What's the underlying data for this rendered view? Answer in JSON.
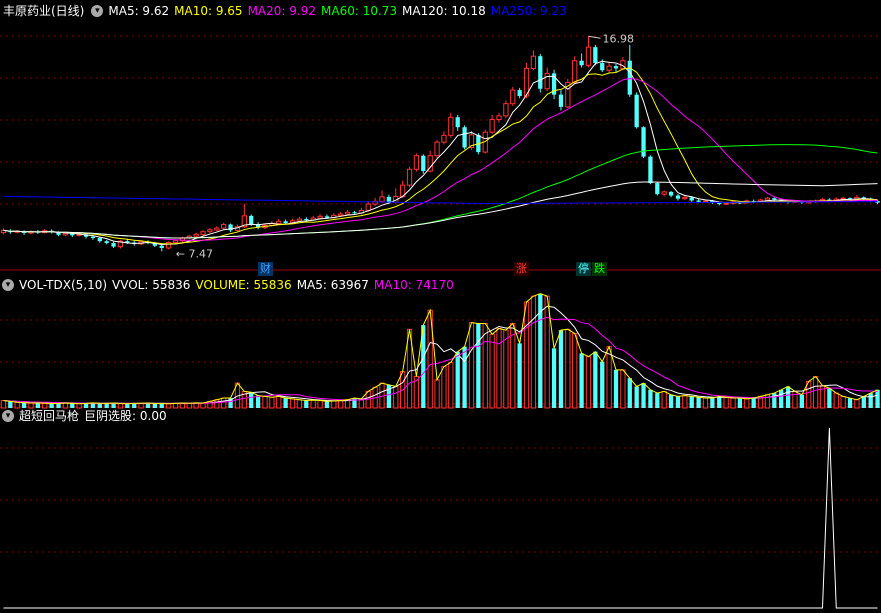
{
  "main_header": {
    "stock_name": "丰原药业(日线)",
    "indicators": [
      {
        "label": "MA5: 9.62",
        "color": "#ffffff"
      },
      {
        "label": "MA10: 9.65",
        "color": "#ffff00"
      },
      {
        "label": "MA20: 9.92",
        "color": "#ff00ff"
      },
      {
        "label": "MA60: 10.73",
        "color": "#00ff00"
      },
      {
        "label": "MA120: 10.18",
        "color": "#ffffff"
      },
      {
        "label": "MA250: 9.23",
        "color": "#0000ff"
      }
    ]
  },
  "vol_header": {
    "name": "VOL-TDX(5,10)",
    "indicators": [
      {
        "label": "VVOL: 55836",
        "color": "#ffffff"
      },
      {
        "label": "VOLUME: 55836",
        "color": "#ffff00"
      },
      {
        "label": "MA5: 63967",
        "color": "#ffffff"
      },
      {
        "label": "MA10: 74170",
        "color": "#ff00ff"
      }
    ]
  },
  "sub_header": {
    "name": "超短回马枪",
    "indicators": [
      {
        "label": "巨阴选股: 0.00",
        "color": "#ffffff"
      }
    ]
  },
  "annotations": {
    "high_label": "16.98",
    "low_label": "7.47",
    "markers": [
      {
        "text": "财",
        "color": "#4a9eff",
        "bg": "#003366"
      },
      {
        "text": "涨",
        "color": "#ff3333",
        "bg": "#330000"
      },
      {
        "text": "停",
        "color": "#54ffff",
        "bg": "#003333"
      },
      {
        "text": "跌",
        "color": "#00ff00",
        "bg": "#003300"
      }
    ]
  },
  "colors": {
    "up": "#ff3232",
    "down": "#54ffff",
    "grid": "#800000",
    "ma5": "#ffffff",
    "ma10": "#ffff00",
    "ma20": "#ff00ff",
    "ma60": "#00ff00",
    "ma120": "#ffffff",
    "ma250": "#0000ff"
  },
  "chart_data": {
    "type": "candlestick",
    "price_range": [
      7.0,
      17.7
    ],
    "high": 16.98,
    "low": 7.47,
    "candles": [
      [
        8.3,
        8.4,
        8.48,
        8.22
      ],
      [
        8.38,
        8.32,
        8.45,
        8.25
      ],
      [
        8.32,
        8.36,
        8.42,
        8.26
      ],
      [
        8.36,
        8.28,
        8.4,
        8.2
      ],
      [
        8.28,
        8.34,
        8.4,
        8.22
      ],
      [
        8.34,
        8.3,
        8.42,
        8.24
      ],
      [
        8.3,
        8.38,
        8.46,
        8.26
      ],
      [
        8.38,
        8.32,
        8.44,
        8.26
      ],
      [
        8.32,
        8.2,
        8.36,
        8.14
      ],
      [
        8.2,
        8.26,
        8.32,
        8.14
      ],
      [
        8.26,
        8.18,
        8.3,
        8.1
      ],
      [
        8.18,
        8.22,
        8.28,
        8.12
      ],
      [
        8.22,
        8.12,
        8.26,
        8.04
      ],
      [
        8.12,
        8.06,
        8.18,
        7.98
      ],
      [
        8.06,
        7.92,
        8.1,
        7.86
      ],
      [
        7.92,
        7.84,
        7.98,
        7.78
      ],
      [
        7.84,
        7.68,
        7.9,
        7.62
      ],
      [
        7.68,
        7.92,
        7.98,
        7.6
      ],
      [
        7.92,
        7.86,
        8.02,
        7.8
      ],
      [
        7.86,
        7.8,
        7.94,
        7.72
      ],
      [
        7.8,
        7.9,
        7.96,
        7.74
      ],
      [
        7.9,
        7.84,
        7.96,
        7.78
      ],
      [
        7.84,
        7.72,
        7.88,
        7.66
      ],
      [
        7.72,
        7.62,
        7.78,
        7.47
      ],
      [
        7.62,
        7.86,
        7.92,
        7.56
      ],
      [
        7.86,
        7.94,
        8.0,
        7.8
      ],
      [
        7.94,
        8.06,
        8.12,
        7.88
      ],
      [
        8.06,
        8.14,
        8.2,
        8.0
      ],
      [
        8.14,
        8.22,
        8.3,
        8.08
      ],
      [
        8.22,
        8.34,
        8.4,
        8.16
      ],
      [
        8.34,
        8.42,
        8.5,
        8.28
      ],
      [
        8.42,
        8.5,
        8.58,
        8.36
      ],
      [
        8.5,
        8.66,
        8.74,
        8.44
      ],
      [
        8.66,
        8.4,
        8.7,
        8.32
      ],
      [
        8.4,
        8.56,
        8.66,
        8.34
      ],
      [
        8.56,
        9.04,
        9.58,
        8.5
      ],
      [
        9.04,
        8.68,
        9.1,
        8.6
      ],
      [
        8.68,
        8.52,
        8.76,
        8.44
      ],
      [
        8.52,
        8.62,
        8.7,
        8.46
      ],
      [
        8.62,
        8.7,
        8.8,
        8.56
      ],
      [
        8.7,
        8.8,
        8.9,
        8.64
      ],
      [
        8.8,
        8.72,
        8.88,
        8.66
      ],
      [
        8.72,
        8.82,
        8.92,
        8.68
      ],
      [
        8.82,
        8.9,
        9.0,
        8.76
      ],
      [
        8.9,
        8.86,
        8.98,
        8.8
      ],
      [
        8.86,
        8.94,
        9.04,
        8.82
      ],
      [
        8.94,
        9.02,
        9.12,
        8.88
      ],
      [
        9.02,
        8.96,
        9.1,
        8.9
      ],
      [
        8.96,
        9.06,
        9.16,
        8.92
      ],
      [
        9.06,
        9.12,
        9.22,
        9.0
      ],
      [
        9.12,
        9.2,
        9.3,
        9.06
      ],
      [
        9.2,
        9.16,
        9.26,
        9.1
      ],
      [
        9.16,
        9.28,
        9.4,
        9.1
      ],
      [
        9.28,
        9.56,
        9.7,
        9.22
      ],
      [
        9.56,
        9.68,
        9.84,
        9.48
      ],
      [
        9.68,
        9.88,
        10.16,
        9.6
      ],
      [
        9.88,
        9.64,
        9.98,
        9.56
      ],
      [
        9.64,
        9.9,
        10.26,
        9.58
      ],
      [
        9.9,
        10.4,
        10.6,
        9.84
      ],
      [
        10.4,
        11.1,
        11.22,
        10.3
      ],
      [
        11.1,
        11.7,
        11.8,
        11.0
      ],
      [
        11.7,
        11.02,
        11.76,
        10.9
      ],
      [
        11.02,
        11.7,
        11.92,
        10.96
      ],
      [
        11.7,
        12.3,
        12.4,
        11.6
      ],
      [
        12.3,
        12.6,
        12.78,
        12.2
      ],
      [
        12.6,
        13.4,
        13.6,
        12.5
      ],
      [
        13.4,
        12.96,
        13.5,
        12.8
      ],
      [
        12.96,
        12.06,
        13.04,
        11.98
      ],
      [
        12.06,
        12.62,
        12.8,
        11.96
      ],
      [
        12.62,
        11.86,
        12.7,
        11.76
      ],
      [
        11.86,
        12.74,
        12.86,
        11.8
      ],
      [
        12.74,
        13.3,
        13.5,
        12.66
      ],
      [
        13.3,
        13.46,
        13.6,
        13.16
      ],
      [
        13.46,
        14.0,
        14.14,
        13.36
      ],
      [
        14.0,
        14.6,
        14.74,
        13.9
      ],
      [
        14.6,
        14.34,
        14.7,
        14.24
      ],
      [
        14.34,
        15.56,
        15.8,
        14.24
      ],
      [
        15.56,
        16.1,
        16.36,
        15.48
      ],
      [
        16.1,
        14.66,
        16.2,
        14.5
      ],
      [
        14.66,
        15.34,
        15.6,
        14.56
      ],
      [
        15.34,
        14.4,
        15.5,
        14.2
      ],
      [
        14.4,
        13.86,
        14.6,
        13.7
      ],
      [
        13.86,
        14.94,
        15.1,
        13.8
      ],
      [
        14.94,
        15.9,
        16.1,
        14.86
      ],
      [
        15.9,
        15.7,
        16.22,
        15.6
      ],
      [
        15.7,
        16.5,
        16.98,
        15.6
      ],
      [
        16.5,
        15.8,
        16.6,
        15.7
      ],
      [
        15.8,
        15.48,
        15.96,
        15.4
      ],
      [
        15.48,
        15.66,
        15.86,
        15.38
      ],
      [
        15.66,
        15.56,
        15.76,
        15.4
      ],
      [
        15.56,
        15.9,
        16.06,
        15.5
      ],
      [
        15.9,
        14.4,
        16.6,
        14.3
      ],
      [
        14.4,
        12.96,
        14.5,
        12.9
      ],
      [
        12.96,
        11.66,
        13.0,
        11.6
      ],
      [
        11.66,
        10.49,
        11.72,
        10.44
      ],
      [
        10.49,
        10.0,
        10.52,
        9.94
      ],
      [
        10.0,
        10.1,
        10.16,
        9.9
      ],
      [
        10.1,
        9.94,
        10.14,
        9.86
      ],
      [
        9.94,
        9.8,
        10.0,
        9.72
      ],
      [
        9.8,
        9.86,
        9.92,
        9.74
      ],
      [
        9.86,
        9.72,
        9.9,
        9.66
      ],
      [
        9.72,
        9.66,
        9.78,
        9.6
      ],
      [
        9.66,
        9.7,
        9.76,
        9.62
      ],
      [
        9.7,
        9.62,
        9.74,
        9.56
      ],
      [
        9.62,
        9.56,
        9.66,
        9.5
      ],
      [
        9.56,
        9.6,
        9.66,
        9.52
      ],
      [
        9.6,
        9.66,
        9.72,
        9.54
      ],
      [
        9.66,
        9.62,
        9.7,
        9.56
      ],
      [
        9.62,
        9.7,
        9.76,
        9.58
      ],
      [
        9.7,
        9.66,
        9.76,
        9.6
      ],
      [
        9.66,
        9.74,
        9.8,
        9.62
      ],
      [
        9.74,
        9.82,
        9.88,
        9.7
      ],
      [
        9.82,
        9.76,
        9.86,
        9.7
      ],
      [
        9.76,
        9.7,
        9.8,
        9.64
      ],
      [
        9.7,
        9.64,
        9.74,
        9.58
      ],
      [
        9.64,
        9.68,
        9.74,
        9.6
      ],
      [
        9.68,
        9.62,
        9.72,
        9.56
      ],
      [
        9.62,
        9.66,
        9.72,
        9.58
      ],
      [
        9.66,
        9.7,
        9.76,
        9.62
      ],
      [
        9.7,
        9.76,
        9.84,
        9.66
      ],
      [
        9.76,
        9.72,
        9.82,
        9.68
      ],
      [
        9.72,
        9.78,
        9.86,
        9.68
      ],
      [
        9.78,
        9.82,
        9.88,
        9.72
      ],
      [
        9.82,
        9.76,
        9.86,
        9.7
      ],
      [
        9.76,
        9.86,
        9.96,
        9.72
      ],
      [
        9.86,
        9.8,
        9.9,
        9.74
      ],
      [
        9.8,
        9.7,
        9.84,
        9.64
      ],
      [
        9.7,
        9.62,
        9.74,
        9.56
      ]
    ],
    "volume": [
      9000,
      8000,
      7000,
      6500,
      6000,
      6200,
      5800,
      5500,
      5600,
      6000,
      5800,
      5200,
      5600,
      6200,
      5800,
      5600,
      6000,
      5400,
      5200,
      5600,
      5800,
      6000,
      5600,
      5400,
      5200,
      5600,
      6000,
      5800,
      6200,
      6000,
      8000,
      10000,
      12000,
      12000,
      30000,
      20000,
      19000,
      15000,
      14000,
      13000,
      14000,
      12000,
      11000,
      10000,
      9000,
      9500,
      9000,
      8000,
      8500,
      9000,
      10000,
      12000,
      11000,
      20000,
      25000,
      30000,
      28000,
      26000,
      44000,
      95000,
      38000,
      100000,
      118000,
      34000,
      50000,
      55000,
      68000,
      74000,
      103000,
      102000,
      102000,
      89000,
      96000,
      94000,
      102000,
      78000,
      128000,
      135000,
      138000,
      135000,
      72000,
      94000,
      95000,
      90000,
      66000,
      62000,
      68000,
      56000,
      74000,
      46000,
      46000,
      36000,
      26000,
      30000,
      22000,
      18000,
      20000,
      16000,
      14000,
      15000,
      14000,
      13000,
      12000,
      12000,
      14000,
      13000,
      12000,
      12000,
      11000,
      12000,
      14000,
      16000,
      18000,
      22000,
      26000,
      20000,
      16000,
      32000,
      38000,
      27000,
      24000,
      18000,
      14000,
      12000,
      10000,
      14000,
      18000,
      22000
    ],
    "signal_index": 120
  }
}
